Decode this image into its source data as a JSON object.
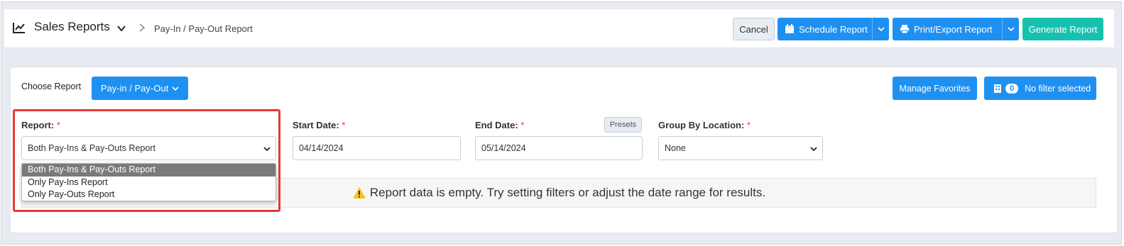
{
  "header": {
    "title": "Sales Reports",
    "breadcrumb": "Pay-In / Pay-Out Report",
    "buttons": {
      "cancel": "Cancel",
      "schedule": "Schedule Report",
      "print": "Print/Export Report",
      "generate": "Generate Report"
    }
  },
  "toolbar": {
    "choose_label": "Choose Report",
    "choose_value": "Pay-in / Pay-Out",
    "manage_favorites": "Manage Favorites",
    "filter_count": "0",
    "filter_text": "No filter selected"
  },
  "filters": {
    "report_label": "Report:",
    "report_value": "Both Pay-Ins & Pay-Outs Report",
    "report_options": [
      "Both Pay-Ins & Pay-Outs Report",
      "Only Pay-Ins Report",
      "Only Pay-Outs Report"
    ],
    "start_label": "Start Date:",
    "start_value": "04/14/2024",
    "end_label": "End Date:",
    "end_value": "05/14/2024",
    "presets": "Presets",
    "group_label": "Group By Location:",
    "group_value": "None",
    "required_mark": "*"
  },
  "empty_message": "Report data is empty. Try setting filters or adjust the date range for results.",
  "colors": {
    "primary": "#1e90f2",
    "teal": "#17c1b0",
    "required": "#e0413a",
    "highlight": "#e53935",
    "warning": "#f5c518"
  },
  "icons": {
    "title": "chart-line-icon",
    "schedule": "calendar-icon",
    "print": "printer-icon",
    "filter": "building-icon",
    "warning": "warning-icon"
  }
}
